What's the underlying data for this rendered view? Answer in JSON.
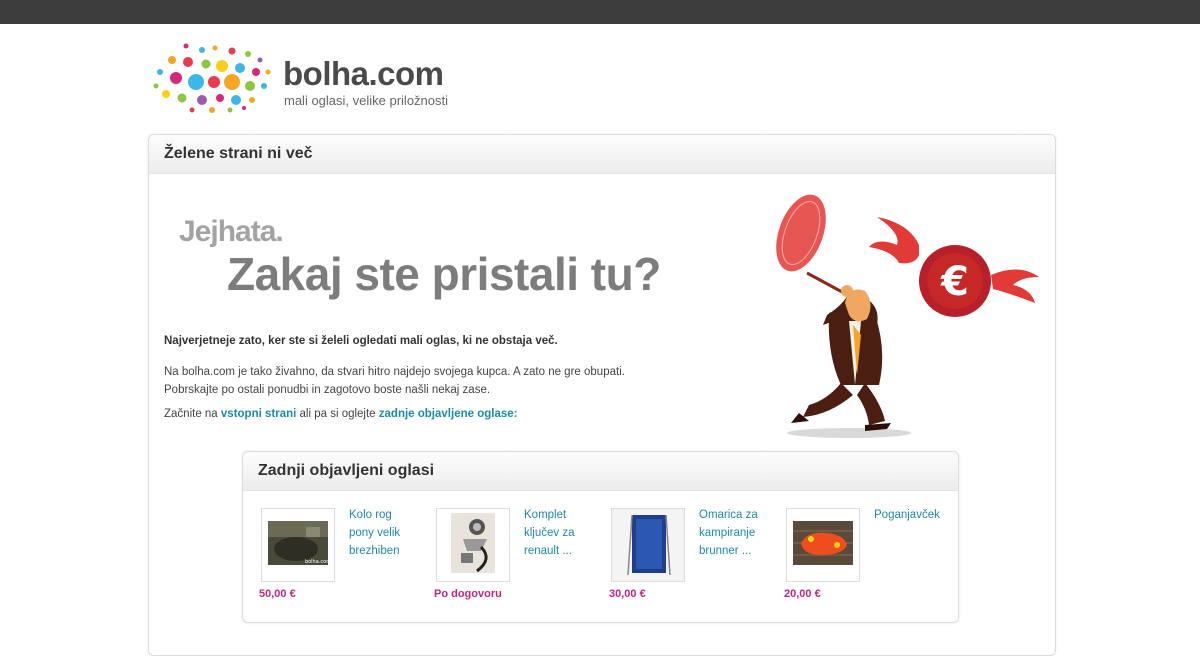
{
  "brand": {
    "name": "bolha.com",
    "tagline": "mali oglasi, velike priložnosti"
  },
  "panel": {
    "title": "Želene strani ni več",
    "heading_small": "Jejhata.",
    "heading_large": "Zakaj ste pristali tu?",
    "intro_bold": "Najverjetneje zato, ker ste si želeli ogledati mali oglas, ki ne obstaja več.",
    "text_line1": "Na bolha.com je tako živahno, da stvari hitro najdejo svojega kupca. A zato ne gre obupati.",
    "text_line2": "Pobrskajte po ostali ponudbi in zagotovo boste našli nekaj zase.",
    "links_prefix": "Začnite na ",
    "link_home": "vstopni strani",
    "links_middle": " ali pa si oglejte ",
    "link_recent": "zadnje objavljene oglase:"
  },
  "recent": {
    "title": "Zadnji objavljeni oglasi",
    "items": [
      {
        "title": "Kolo rog pony velik brezhiben",
        "price": "50,00 €",
        "watermark": "bolha.com"
      },
      {
        "title": "Komplet ključev za renault ...",
        "price": "Po dogovoru"
      },
      {
        "title": "Omarica za kampiranje brunner ...",
        "price": "30,00 €"
      },
      {
        "title": "Poganjavček",
        "price": "20,00 €"
      }
    ]
  },
  "colors": {
    "topbar": "#3c3c3c",
    "link": "#1d8aa8",
    "price": "#c0277d",
    "illustration_red": "#c62828"
  },
  "icons": {
    "logo": "confetti-dots-logo",
    "illustration": "man-chasing-flying-euro-with-net"
  }
}
